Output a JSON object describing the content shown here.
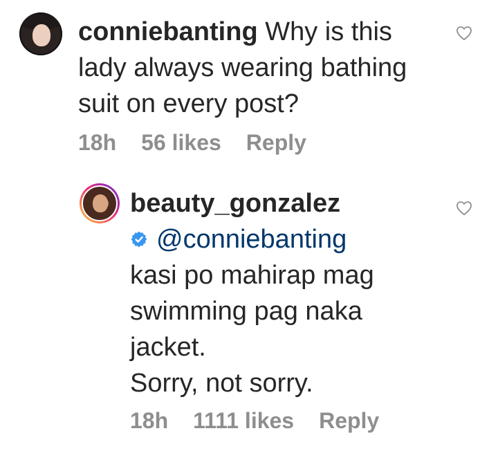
{
  "comments": [
    {
      "username": "conniebanting",
      "text": "Why is this lady always wearing bathing suit on every post?",
      "time": "18h",
      "likes": "56 likes",
      "reply_label": "Reply"
    },
    {
      "username": "beauty_gonzalez",
      "mention": "@conniebanting",
      "lines": [
        "kasi po mahirap mag",
        "swimming pag naka",
        "jacket.",
        "Sorry, not sorry."
      ],
      "time": "18h",
      "likes": "1111 likes",
      "reply_label": "Reply"
    }
  ],
  "icons": {
    "like": "heart-outline-icon",
    "verified": "verified-badge-icon"
  },
  "colors": {
    "text": "#262626",
    "meta": "#8e8e8e",
    "mention": "#00376b",
    "verified": "#3897f0"
  }
}
